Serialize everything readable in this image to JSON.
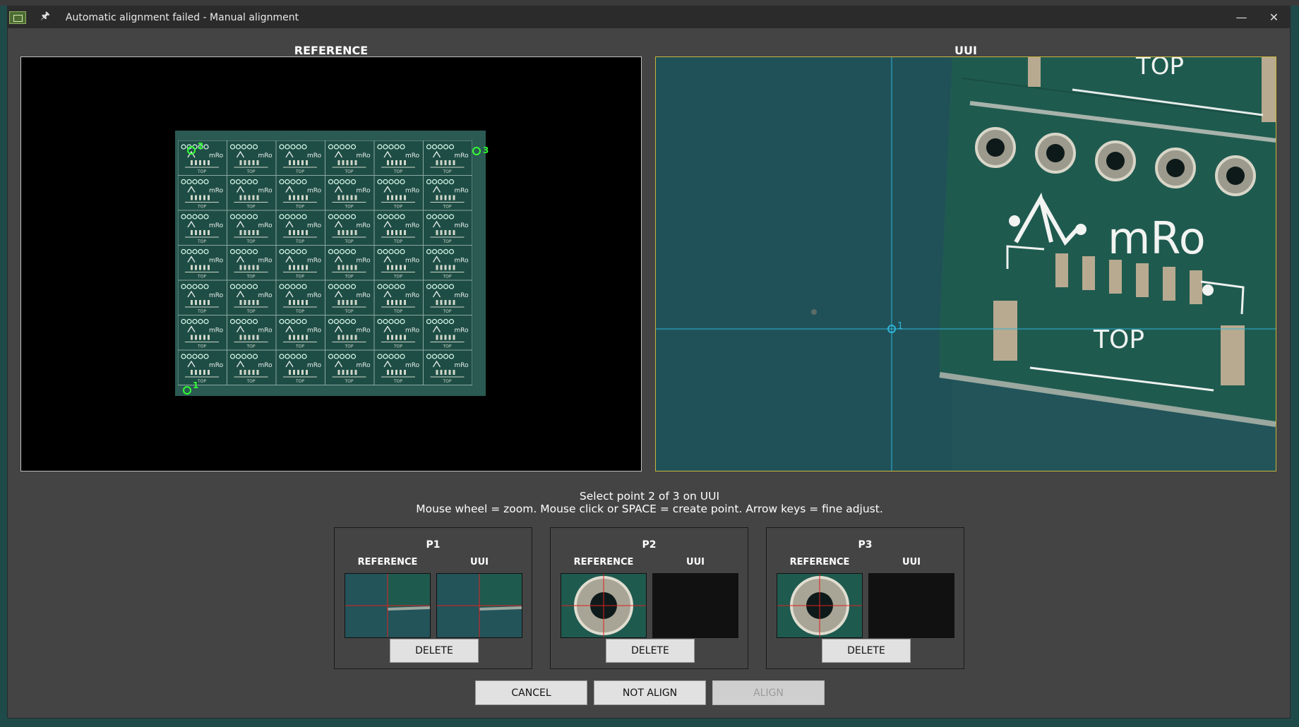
{
  "window": {
    "title": "Automatic alignment failed - Manual alignment"
  },
  "panels": {
    "reference_label": "REFERENCE",
    "uui_label": "UUI"
  },
  "reference_view": {
    "markers": [
      "1",
      "2",
      "3"
    ]
  },
  "uui_view": {
    "markers": [
      "1"
    ],
    "pcb_text_top": "TOP",
    "pcb_text_brand": "mRo",
    "pcb_text_top2": "TOP"
  },
  "instructions": {
    "line1": "Select point 2 of 3 on UUI",
    "line2": "Mouse wheel = zoom. Mouse click or SPACE = create point. Arrow keys = fine adjust."
  },
  "points": [
    {
      "title": "P1",
      "reference_label": "REFERENCE",
      "uui_label": "UUI",
      "delete_label": "DELETE"
    },
    {
      "title": "P2",
      "reference_label": "REFERENCE",
      "uui_label": "UUI",
      "delete_label": "DELETE"
    },
    {
      "title": "P3",
      "reference_label": "REFERENCE",
      "uui_label": "UUI",
      "delete_label": "DELETE"
    }
  ],
  "buttons": {
    "cancel": "CANCEL",
    "not_align": "NOT ALIGN",
    "align": "ALIGN"
  },
  "colors": {
    "accent_cyan": "#2fb4d8",
    "marker_green": "#33ff33",
    "crosshair_red": "#e02020",
    "pcb_green": "#1f5a4f"
  }
}
